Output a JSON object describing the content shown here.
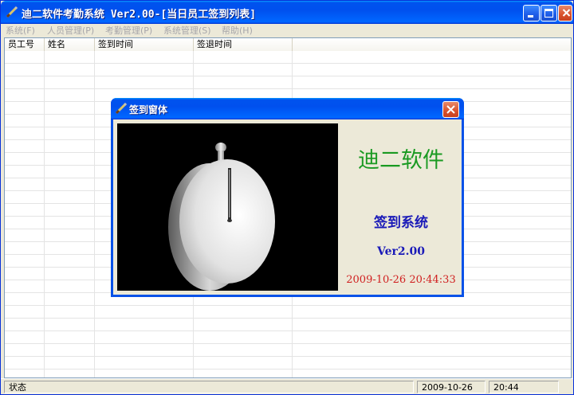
{
  "window": {
    "title": "迪二软件考勤系统 Ver2.00-[当日员工签到列表]",
    "icon": "pen-icon"
  },
  "menu": [
    "系统(F)",
    "人员管理(P)",
    "考勤管理(P)",
    "系统管理(S)",
    "帮助(H)"
  ],
  "table": {
    "columns": [
      "员工号",
      "姓名",
      "签到时间",
      "签退时间"
    ],
    "rows": []
  },
  "statusbar": {
    "label": "状态",
    "date": "2009-10-26",
    "time": "20:44"
  },
  "dialog": {
    "title": "签到窗体",
    "brand": "迪二软件",
    "subtitle": "签到系统",
    "version": "Ver2.00",
    "datetime": "2009-10-26 20:44:33"
  },
  "colors": {
    "brand": "#1a9a22",
    "subtitle": "#1a1ab8",
    "datetime": "#d02020",
    "titlebar": "#0053ee"
  }
}
